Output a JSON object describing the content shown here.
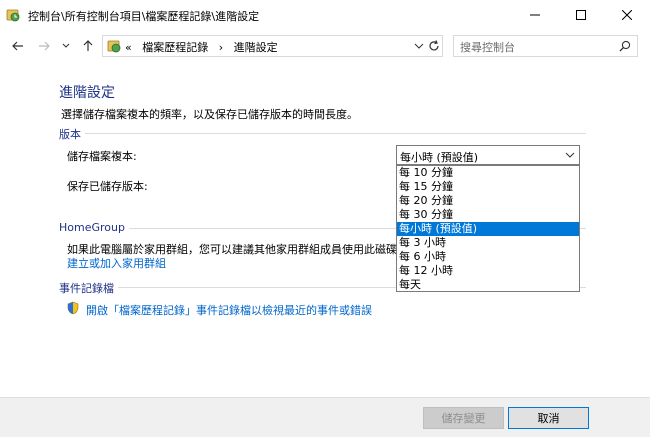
{
  "window": {
    "title": "控制台\\所有控制台項目\\檔案歷程記錄\\進階設定"
  },
  "nav": {
    "address_prefix": "«",
    "address_parent": "檔案歷程記錄",
    "address_sep": "›",
    "address_current": "進階設定",
    "search_placeholder": "搜尋控制台"
  },
  "page": {
    "title": "進階設定",
    "description": "選擇儲存檔案複本的頻率，以及保存已儲存版本的時間長度。",
    "sections": {
      "versions": {
        "label": "版本",
        "save_copies_label": "儲存檔案複本:",
        "keep_versions_label": "保存已儲存版本:"
      },
      "homegroup": {
        "label": "HomeGroup",
        "text": "如果此電腦屬於家用群組，您可以建議其他家用群組成員使用此磁碟",
        "link": "建立或加入家用群組"
      },
      "eventlog": {
        "label": "事件記錄檔",
        "link": "開啟「檔案歷程記錄」事件記錄檔以檢視最近的事件或錯誤"
      }
    }
  },
  "combo": {
    "selected": "每小時 (預設值)",
    "options": [
      "每 10 分鐘",
      "每 15 分鐘",
      "每 20 分鐘",
      "每 30 分鐘",
      "每小時 (預設值)",
      "每 3 小時",
      "每 6 小時",
      "每 12 小時",
      "每天"
    ],
    "highlighted_index": 4
  },
  "buttons": {
    "save": "儲存變更",
    "cancel": "取消"
  },
  "colors": {
    "accent": "#0078d7",
    "heading": "#1e3287",
    "link": "#0066cc"
  }
}
